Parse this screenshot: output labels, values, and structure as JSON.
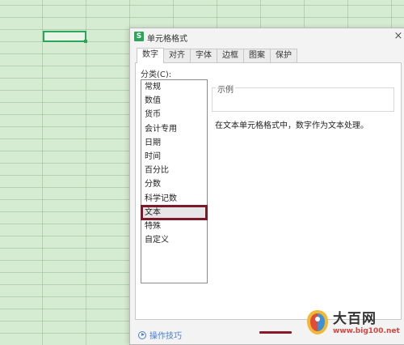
{
  "dialog": {
    "title": "单元格格式",
    "app_icon_letter": "S",
    "close_symbol": "×"
  },
  "tabs": [
    {
      "label": "数字",
      "active": true
    },
    {
      "label": "对齐"
    },
    {
      "label": "字体"
    },
    {
      "label": "边框"
    },
    {
      "label": "图案"
    },
    {
      "label": "保护"
    }
  ],
  "category": {
    "label": "分类(C):",
    "items": [
      "常规",
      "数值",
      "货币",
      "会计专用",
      "日期",
      "时间",
      "百分比",
      "分数",
      "科学记数",
      "文本",
      "特殊",
      "自定义"
    ],
    "selected": "文本"
  },
  "sample": {
    "label": "示例"
  },
  "description": "在文本单元格格式中，数字作为文本处理。",
  "footer": {
    "tips_link": "操作技巧"
  },
  "watermark": {
    "name": "大百网",
    "url": "www.big100.net"
  },
  "colors": {
    "accent_green": "#2aa55a",
    "highlight": "#7a1a2a",
    "link": "#4b7ecf"
  }
}
